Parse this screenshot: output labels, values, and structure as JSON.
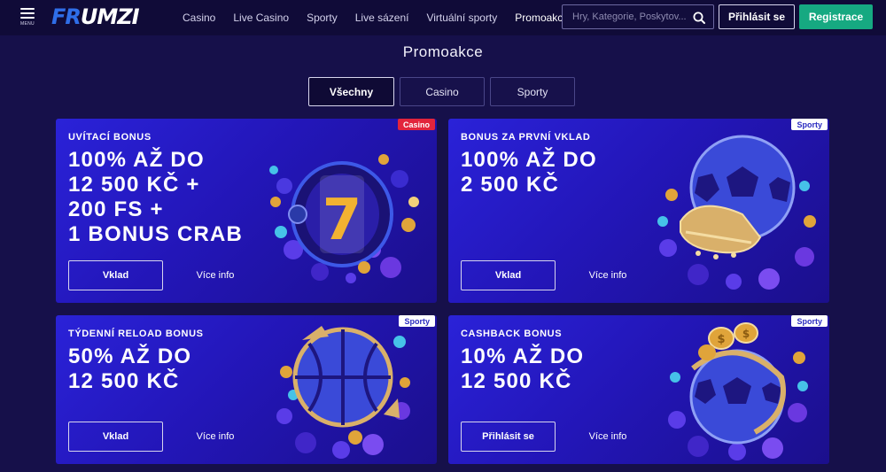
{
  "header": {
    "menu_label": "MENU",
    "logo_part1": "FR",
    "logo_part2": "UMZI",
    "nav": [
      "Casino",
      "Live Casino",
      "Sporty",
      "Live sázení",
      "Virtuální sporty",
      "Promoakce"
    ],
    "active_nav": "Promoakce",
    "search_placeholder": "Hry, Kategorie, Poskytov...",
    "login_label": "Přihlásit se",
    "register_label": "Registrace",
    "register_color": "#16a981"
  },
  "page": {
    "title": "Promoakce",
    "tabs": [
      {
        "label": "Všechny",
        "active": true
      },
      {
        "label": "Casino",
        "active": false
      },
      {
        "label": "Sporty",
        "active": false
      }
    ]
  },
  "promos": [
    {
      "badge": "Casino",
      "badge_color": "#e2243c",
      "subtitle": "UVÍTACÍ BONUS",
      "headline": "100% AŽ DO\n12 500 KČ +\n200 FS +\n1 BONUS CRAB",
      "primary_label": "Vklad",
      "info_label": "Více info",
      "art": "slot-reel-seven-icon"
    },
    {
      "badge": "Sporty",
      "badge_color": "#ffffff",
      "subtitle": "BONUS ZA PRVNÍ VKLAD",
      "headline": "100% AŽ DO\n2 500 KČ",
      "primary_label": "Vklad",
      "info_label": "Více info",
      "art": "soccer-ball-boot-icon"
    },
    {
      "badge": "Sporty",
      "badge_color": "#ffffff",
      "subtitle": "TÝDENNÍ RELOAD BONUS",
      "headline": "50% AŽ DO\n12 500 KČ",
      "primary_label": "Vklad",
      "info_label": "Více info",
      "art": "basketball-icon"
    },
    {
      "badge": "Sporty",
      "badge_color": "#ffffff",
      "subtitle": "CASHBACK BONUS",
      "headline": "10% AŽ DO\n12 500 KČ",
      "primary_label": "Přihlásit se",
      "info_label": "Více info",
      "art": "soccer-ball-coins-icon"
    }
  ]
}
